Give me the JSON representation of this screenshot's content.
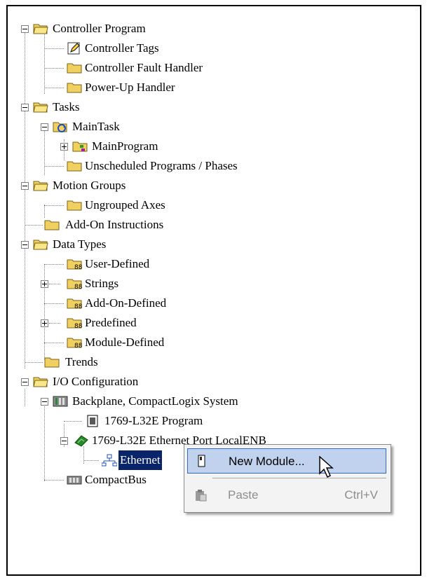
{
  "tree": {
    "items": [
      {
        "label": "Controller Program",
        "icon": "folder-open-icon"
      },
      {
        "label": "Controller Tags",
        "icon": "tags-pencil-icon"
      },
      {
        "label": "Controller Fault Handler",
        "icon": "folder-icon"
      },
      {
        "label": "Power-Up Handler",
        "icon": "folder-icon"
      },
      {
        "label": "Tasks",
        "icon": "folder-open-icon"
      },
      {
        "label": "MainTask",
        "icon": "task-icon"
      },
      {
        "label": "MainProgram",
        "icon": "program-icon"
      },
      {
        "label": "Unscheduled Programs / Phases",
        "icon": "folder-icon"
      },
      {
        "label": "Motion Groups",
        "icon": "folder-open-icon"
      },
      {
        "label": "Ungrouped Axes",
        "icon": "folder-icon"
      },
      {
        "label": "Add-On Instructions",
        "icon": "folder-icon"
      },
      {
        "label": "Data Types",
        "icon": "folder-open-icon"
      },
      {
        "label": "User-Defined",
        "icon": "datatype-folder-icon"
      },
      {
        "label": "Strings",
        "icon": "datatype-folder-icon"
      },
      {
        "label": "Add-On-Defined",
        "icon": "datatype-folder-icon"
      },
      {
        "label": "Predefined",
        "icon": "datatype-folder-icon"
      },
      {
        "label": "Module-Defined",
        "icon": "datatype-folder-icon"
      },
      {
        "label": "Trends",
        "icon": "folder-icon"
      },
      {
        "label": "I/O Configuration",
        "icon": "folder-open-icon"
      },
      {
        "label": "Backplane, CompactLogix System",
        "icon": "backplane-icon"
      },
      {
        "label": "1769-L32E Program",
        "icon": "controller-module-icon"
      },
      {
        "label": "1769-L32E Ethernet Port LocalENB",
        "icon": "ethernet-port-icon"
      },
      {
        "label": "Ethernet",
        "icon": "network-icon"
      },
      {
        "label": "CompactBus",
        "icon": "compactbus-icon"
      }
    ]
  },
  "context_menu": {
    "new_module": "New Module...",
    "paste": "Paste",
    "paste_shortcut": "Ctrl+V"
  },
  "colors": {
    "folder": "#f0d060",
    "selection": "#0a246a",
    "menu_highlight": "#c1d2ee"
  }
}
